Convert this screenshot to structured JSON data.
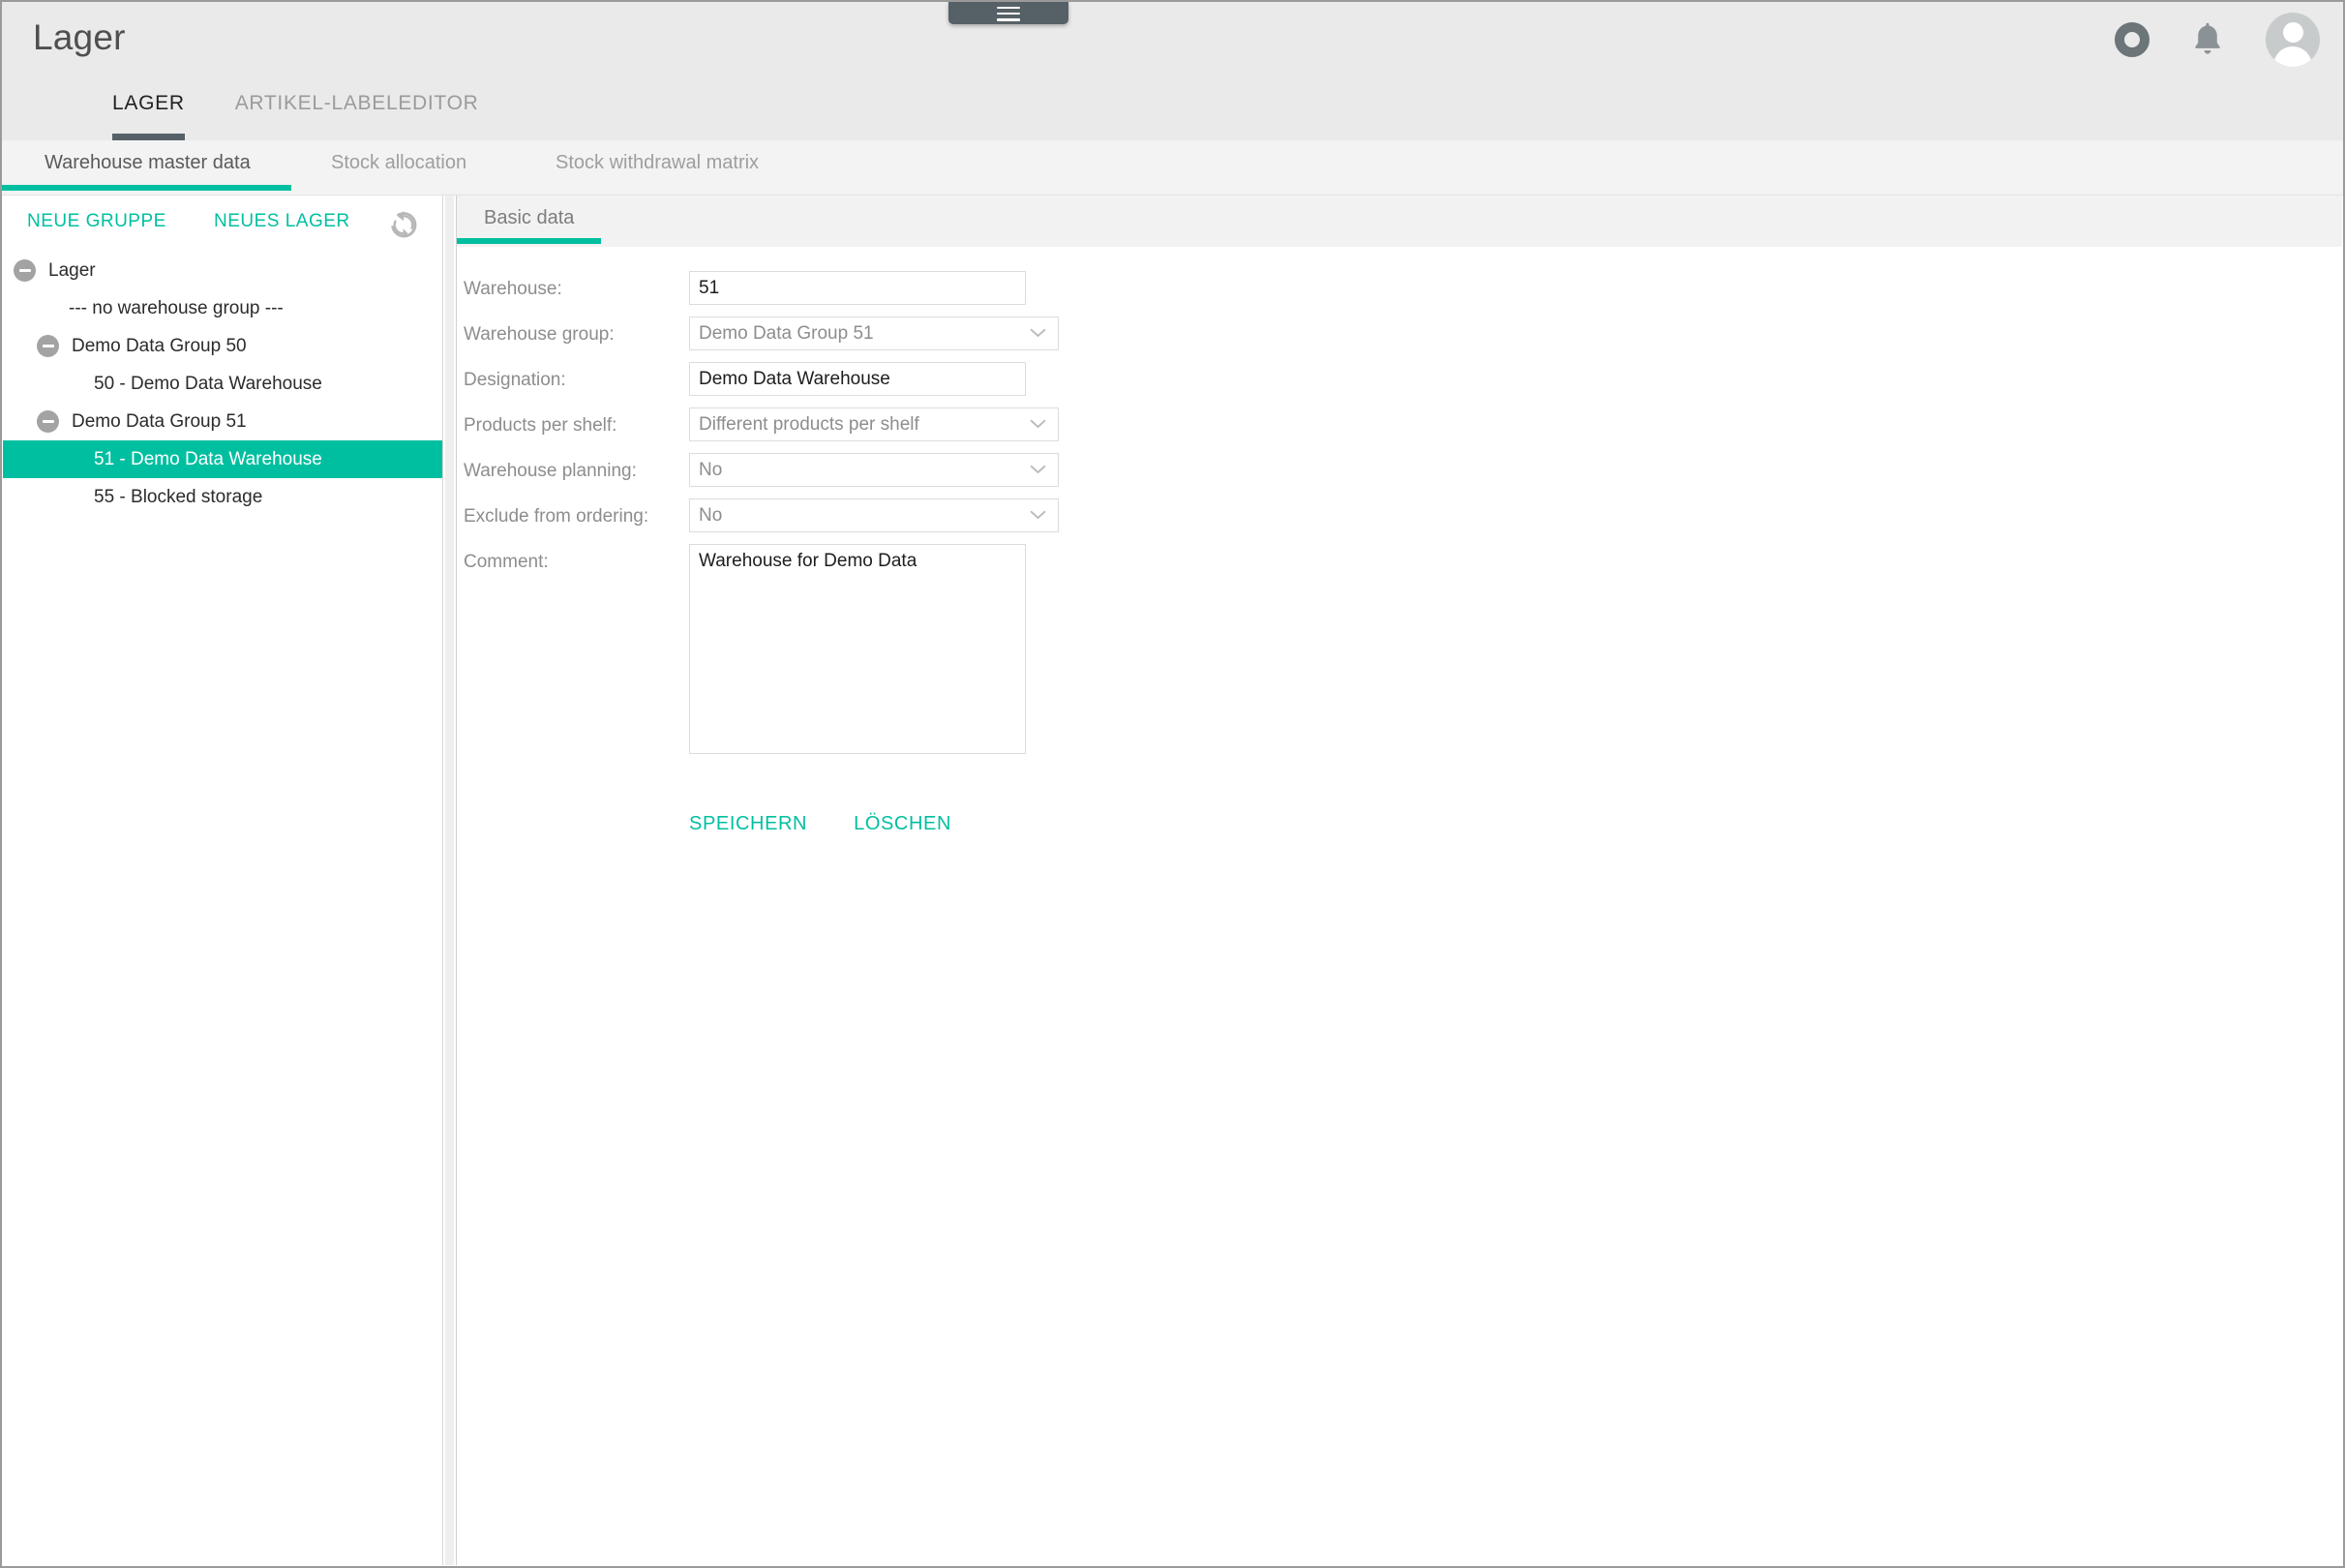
{
  "colors": {
    "accent_teal": "#00bfa0",
    "tab_underline_dark": "#566067",
    "header_bg": "#eaeaea",
    "subtab_bg": "#f3f3f3",
    "selected_row_bg": "#00bfa0"
  },
  "header": {
    "app_title": "Lager",
    "drag_handle_icon": "hamburger-menu-icon",
    "icons": [
      {
        "name": "status-ring-icon"
      },
      {
        "name": "notifications-bell-icon"
      },
      {
        "name": "user-avatar-icon"
      }
    ]
  },
  "main_tabs": [
    {
      "label": "LAGER",
      "active": true
    },
    {
      "label": "ARTIKEL-LABELEDITOR",
      "active": false
    }
  ],
  "sub_tabs": [
    {
      "label": "Warehouse master data",
      "active": true
    },
    {
      "label": "Stock allocation",
      "active": false
    },
    {
      "label": "Stock withdrawal matrix",
      "active": false
    }
  ],
  "sidebar": {
    "toolbar": {
      "new_group_label": "NEUE GRUPPE",
      "new_warehouse_label": "NEUES LAGER",
      "refresh_icon": "refresh-icon"
    },
    "tree": [
      {
        "label": "Lager",
        "level": 0,
        "expandable": true,
        "selected": false
      },
      {
        "label": "--- no warehouse group ---",
        "level": 1,
        "expandable": false,
        "selected": false
      },
      {
        "label": "Demo Data Group 50",
        "level": 1,
        "expandable": true,
        "selected": false
      },
      {
        "label": "50 - Demo Data Warehouse",
        "level": 2,
        "expandable": false,
        "selected": false
      },
      {
        "label": "Demo Data Group 51",
        "level": 1,
        "expandable": true,
        "selected": false
      },
      {
        "label": "51 - Demo Data Warehouse",
        "level": 2,
        "expandable": false,
        "selected": true
      },
      {
        "label": "55 - Blocked storage",
        "level": 2,
        "expandable": false,
        "selected": false
      }
    ]
  },
  "content": {
    "tab_label": "Basic data",
    "fields": [
      {
        "label": "Warehouse:",
        "value": "51",
        "type": "text"
      },
      {
        "label": "Warehouse group:",
        "value": "Demo Data Group 51",
        "type": "select"
      },
      {
        "label": "Designation:",
        "value": "Demo Data Warehouse",
        "type": "text"
      },
      {
        "label": "Products per shelf:",
        "value": "Different products per shelf",
        "type": "select"
      },
      {
        "label": "Warehouse planning:",
        "value": "No",
        "type": "select"
      },
      {
        "label": "Exclude from ordering:",
        "value": "No",
        "type": "select"
      },
      {
        "label": "Comment:",
        "value": "Warehouse for Demo Data",
        "type": "textarea"
      }
    ],
    "actions": {
      "save_label": "SPEICHERN",
      "delete_label": "LÖSCHEN"
    }
  }
}
